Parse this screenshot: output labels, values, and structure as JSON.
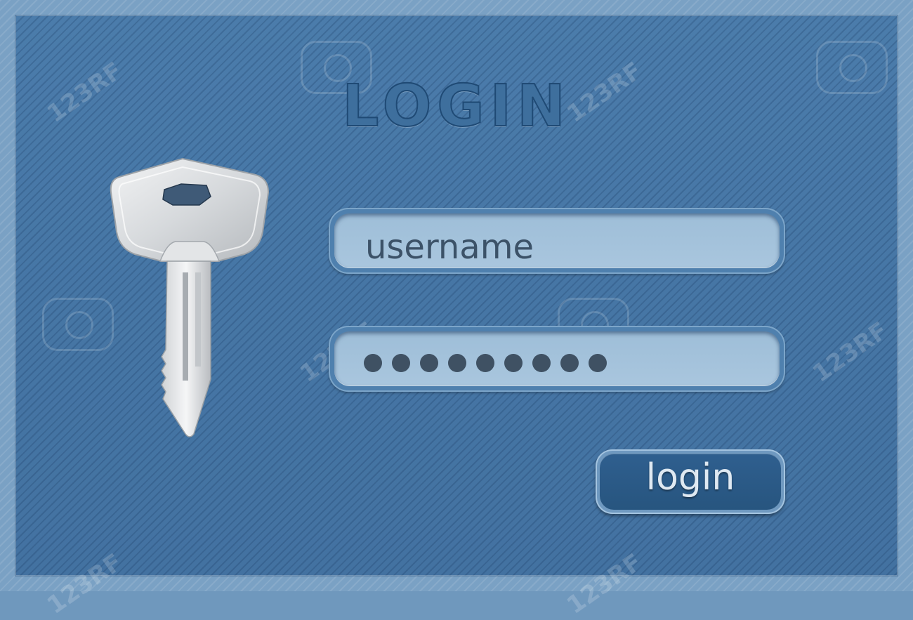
{
  "login_form": {
    "title": "LOGIN",
    "username_value": "username",
    "password_mask_count": 9,
    "submit_label": "login"
  },
  "watermark": {
    "text": "123RF"
  },
  "colors": {
    "panel_blue": "#4676a5",
    "title_fill": "#3e6f9d",
    "title_outline": "#1f4a75",
    "field_fill": "#a9c6de",
    "button_fill": "#27557f",
    "text_dark": "#3c5268"
  },
  "icons": {
    "key": "key-icon"
  }
}
